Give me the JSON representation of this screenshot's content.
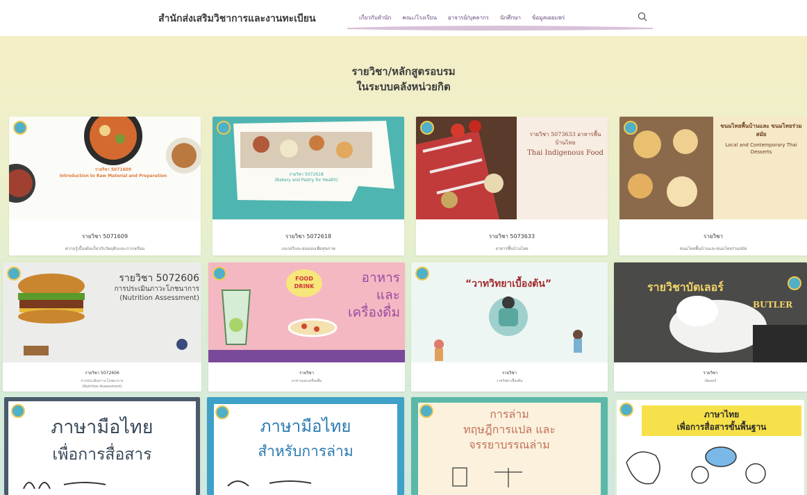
{
  "header": {
    "site_title": "สำนักส่งเสริมวิชาการและงานทะเบียน",
    "nav": [
      "เกี่ยวกับสำนัก",
      "คณะ/โรงเรียน",
      "อาจารย์/บุคลากร",
      "นักศึกษา",
      "ข้อมูลเผยแพร่"
    ],
    "search_icon": "search-icon"
  },
  "hero": {
    "line1": "รายวิชา/หลักสูตรอบรม",
    "line2": "ในระบบคลังหน่วยกิต"
  },
  "row1": [
    {
      "code": "รายวิชา 5071609",
      "desc": "ความรู้เบื้องต้นเกี่ยวกับวัตถุดิบและการเตรียม",
      "thumb_title": "รายวิชา 5071609",
      "thumb_en": "Introduction to Raw Material and Preparation"
    },
    {
      "code": "รายวิชา 5072618",
      "desc": "เบเกอรีและขนมอบเพื่อสุขภาพ",
      "thumb_title": "รายวิชา 5072618",
      "thumb_en": "(Bakery and Pastry for Health)"
    },
    {
      "code": "รายวิชา 5073633",
      "desc": "อาหารพื้นบ้านไทย",
      "thumb_title": "รายวิชา 5073633 อาหารพื้นบ้านไทย",
      "thumb_en": "Thai Indigenous Food"
    },
    {
      "code": "รายวิชา",
      "desc": "ขนมไทยพื้นบ้านและขนมไทยร่วมสมัย",
      "thumb_title": "ขนมไทยพื้นบ้านและ ขนมไทยร่วมสมัย",
      "thumb_en": "Local and Contemporary Thai Desserts"
    }
  ],
  "row2": [
    {
      "code": "รายวิชา 5072606",
      "desc": "การประเมินภาวะโภชนาการ",
      "desc2": "(Nutrition Assessment)",
      "thumb_title": "รายวิชา 5072606",
      "thumb_sub": "การประเมินภาวะโภชนาการ",
      "thumb_en": "(Nutrition Assessment)"
    },
    {
      "code": "รายวิชา",
      "desc": "อาหารและเครื่องดื่ม",
      "thumb_tag1": "FOOD",
      "thumb_tag2": "DRINK",
      "thumb_a": "อาหาร",
      "thumb_b": "และ",
      "thumb_c": "เครื่องดื่ม"
    },
    {
      "code": "รายวิชา",
      "desc": "วาทวิทยาเบื้องต้น",
      "thumb_title": "“วาทวิทยาเบื้องต้น”"
    },
    {
      "code": "รายวิชา",
      "desc": "บัตเลอร์",
      "thumb_title": "รายวิชาบัตเลอร์",
      "thumb_en": "BUTLER"
    }
  ],
  "row3": [
    {
      "a": "ภาษามือไทย",
      "b": "เพื่อการสื่อสาร"
    },
    {
      "a": "ภาษามือไทย",
      "b": "สำหรับการล่าม"
    },
    {
      "a": "การล่าม",
      "b": "ทฤษฎีการแปล และ",
      "c": "จรรยาบรรณล่าม"
    },
    {
      "a": "ภาษาไทย",
      "b": "เพื่อการสื่อสารขั้นพื้นฐาน"
    }
  ]
}
